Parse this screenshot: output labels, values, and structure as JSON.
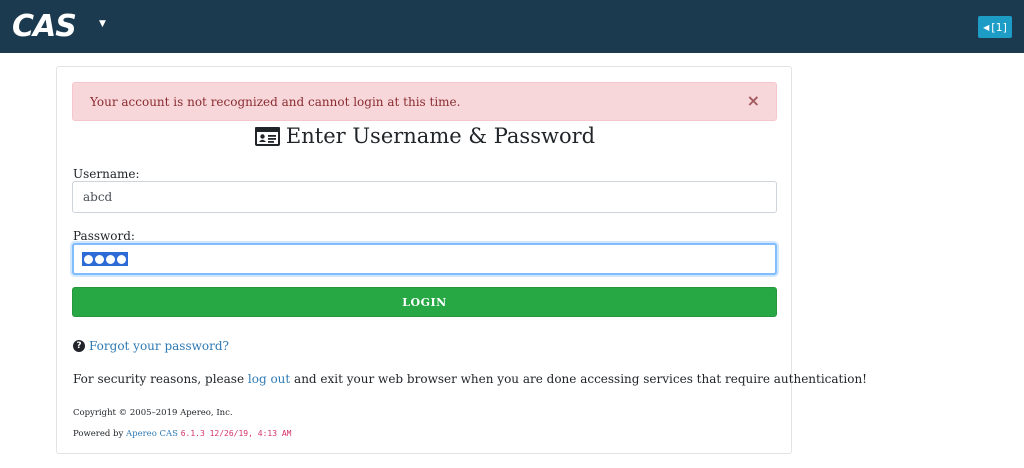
{
  "topbar": {
    "logo_text": "CAS",
    "session_label": "[1]"
  },
  "alert": {
    "message": "Your account is not recognized and cannot login at this time.",
    "close": "×"
  },
  "form": {
    "heading": "Enter Username & Password",
    "username_label": "Username:",
    "username_value": "abcd",
    "password_label": "Password:",
    "password_dots": 4,
    "login_label": "LOGIN"
  },
  "links": {
    "forgot_password": "Forgot your password?"
  },
  "security": {
    "before": "For security reasons, please ",
    "link": "log out",
    "after": " and exit your web browser when you are done accessing services that require authentication!"
  },
  "footer": {
    "copyright": "Copyright © 2005–2019 Apereo, Inc.",
    "powered_prefix": "Powered by ",
    "powered_link": "Apereo CAS",
    "version": "6.1.3 12/26/19, 4:13 AM"
  },
  "colors": {
    "topbar": "#1b3a4f",
    "session_button": "#1d9dc6",
    "alert_bg": "#f8d7da",
    "login_button": "#28a745",
    "link": "#2f7ab4"
  }
}
